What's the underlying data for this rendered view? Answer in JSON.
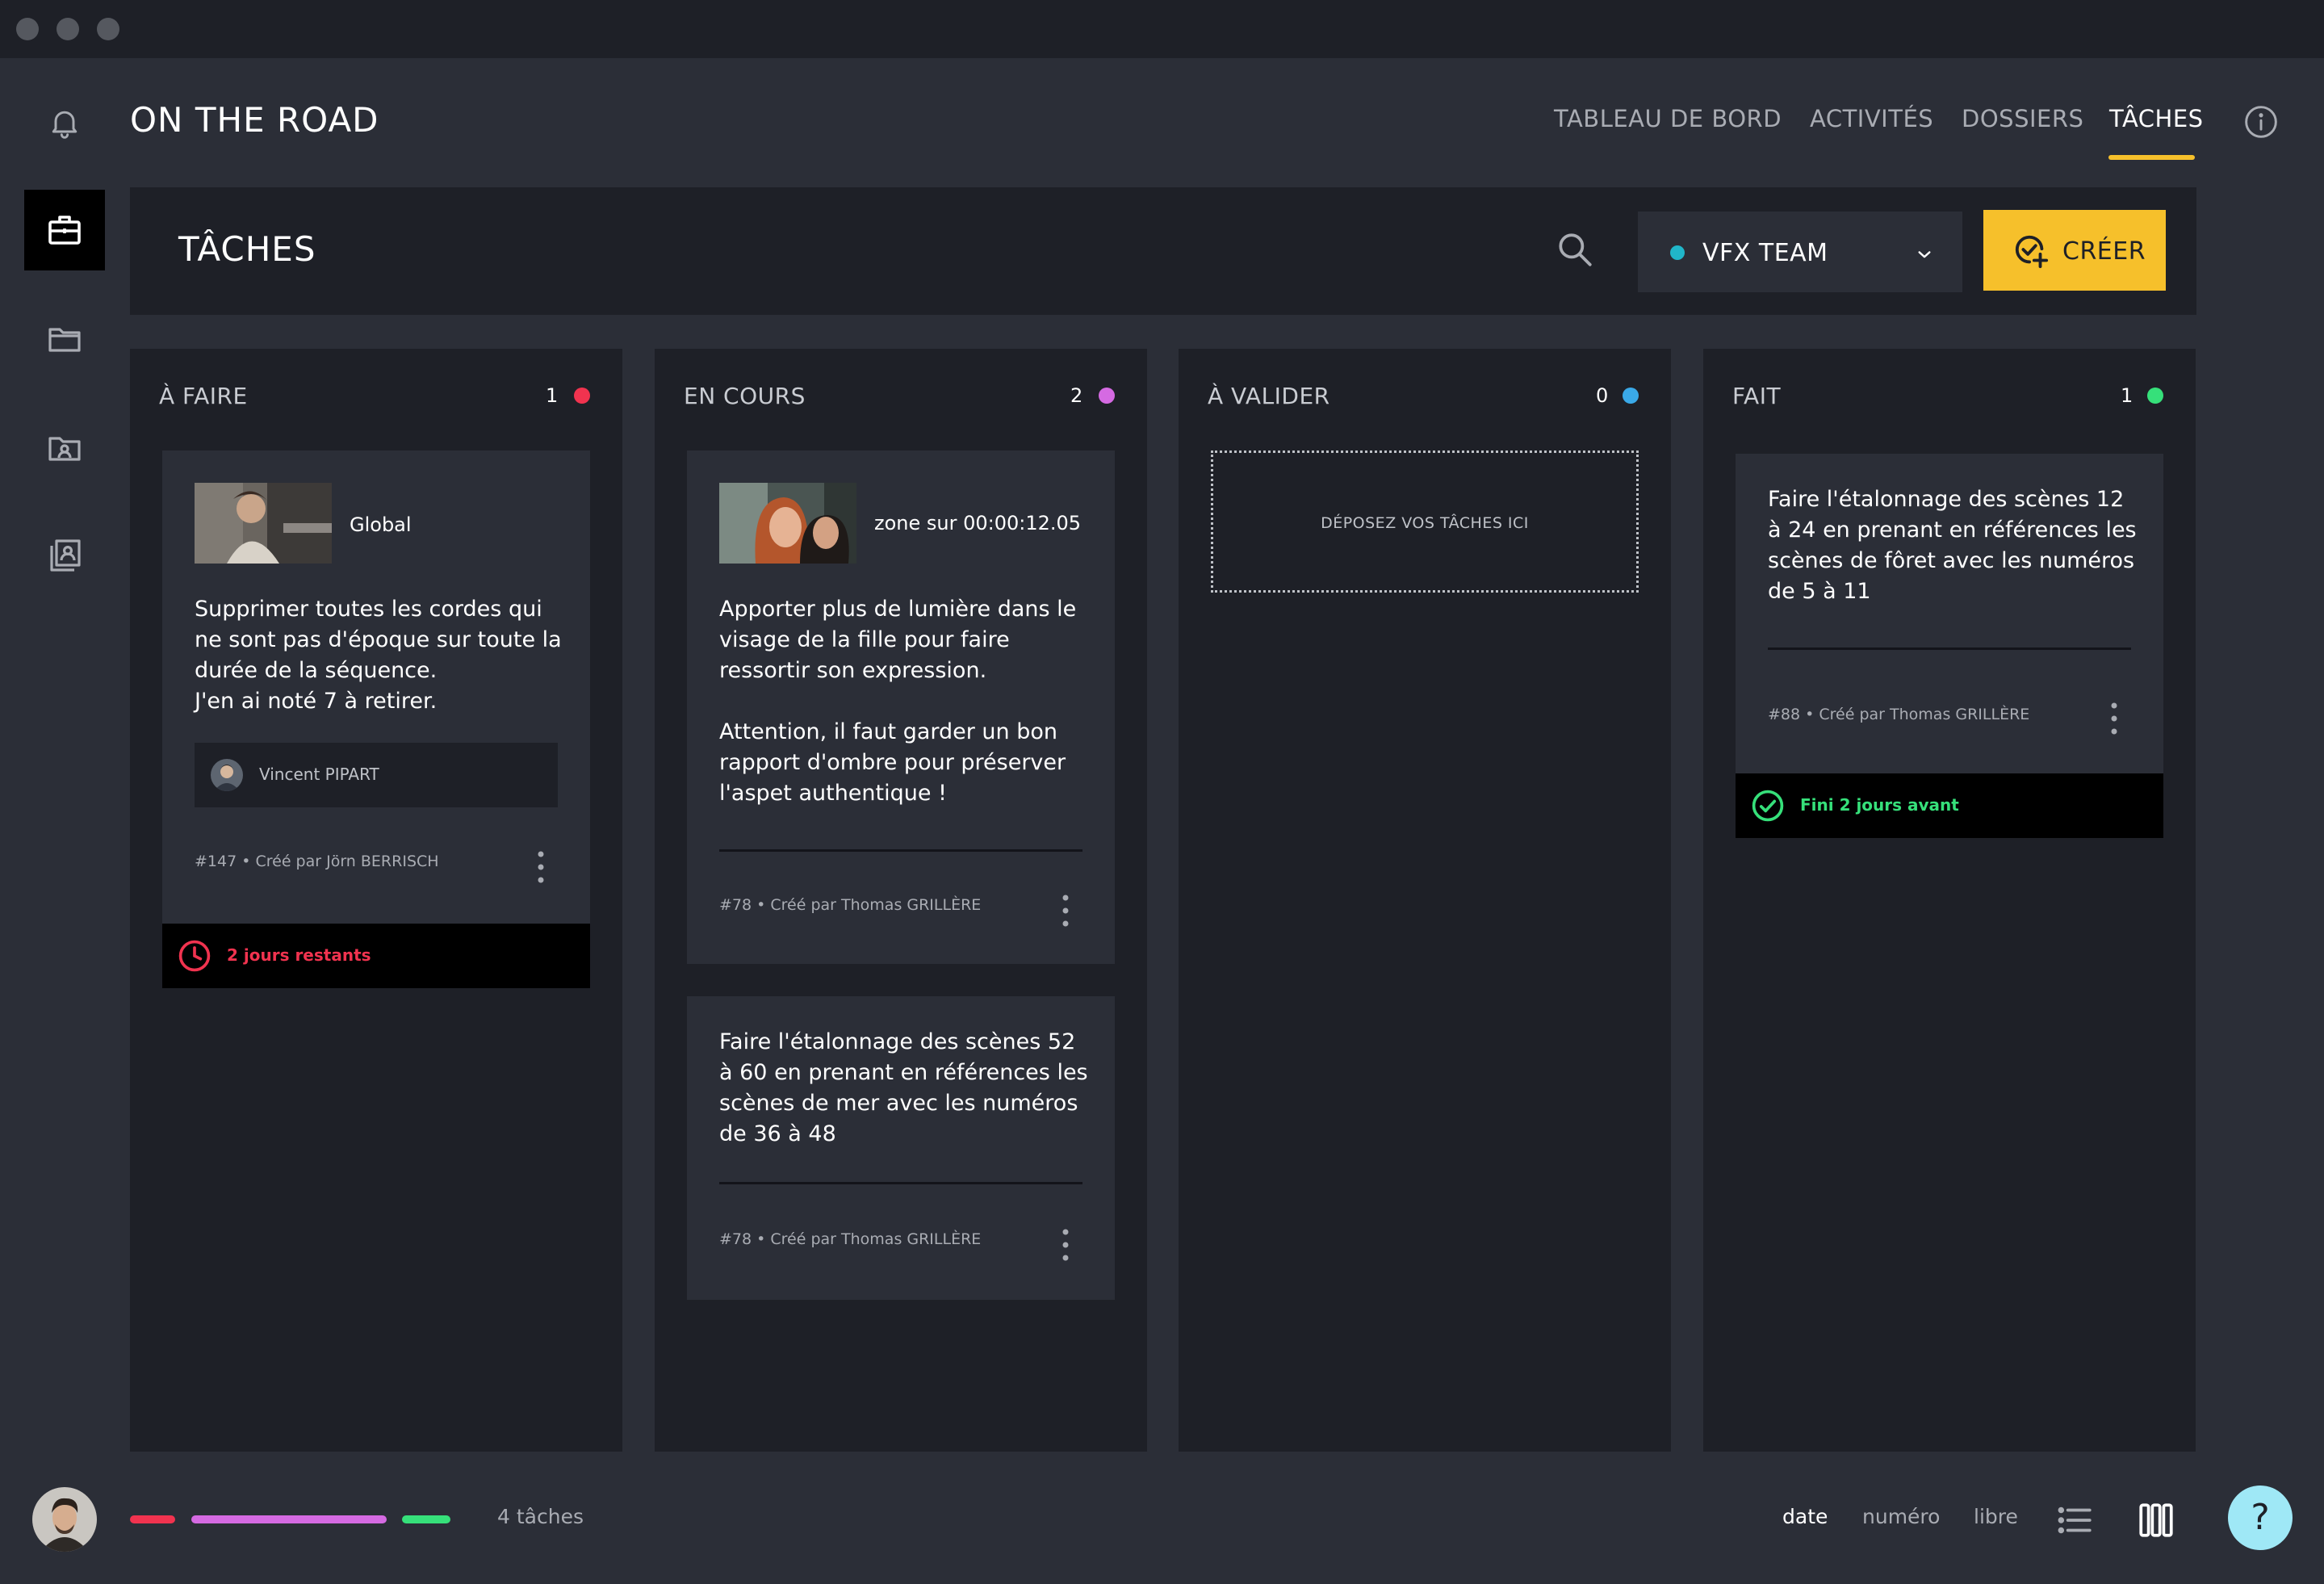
{
  "app": {
    "title": "ON THE ROAD",
    "nav": [
      {
        "label": "TABLEAU DE BORD",
        "active": false
      },
      {
        "label": "ACTIVITÉS",
        "active": false
      },
      {
        "label": "DOSSIERS",
        "active": false
      },
      {
        "label": "TÂCHES",
        "active": true
      }
    ],
    "accent_color": "#f6c02b"
  },
  "page": {
    "title": "TÂCHES",
    "team_select": {
      "label": "VFX TEAM",
      "dot_color": "#20b6c9"
    },
    "create_label": "CRÉER"
  },
  "columns": [
    {
      "title": "À FAIRE",
      "count": "1",
      "dot_color": "#f1334f"
    },
    {
      "title": "EN COURS",
      "count": "2",
      "dot_color": "#d56ae2"
    },
    {
      "title": "À VALIDER",
      "count": "0",
      "dot_color": "#3aa9e8",
      "dropzone": "DÉPOSEZ VOS TÂCHES ICI"
    },
    {
      "title": "FAIT",
      "count": "1",
      "dot_color": "#36e07a"
    }
  ],
  "cards": {
    "todo_1": {
      "thumb_label": "Global",
      "text": "Supprimer toutes les cordes qui ne sont pas d'époque sur toute la durée de la séquence.\nJ'en ai noté 7 à retirer.",
      "assignee": "Vincent PIPART",
      "meta": "#147  •  Créé par Jörn BERRISCH",
      "footer": "2 jours restants",
      "footer_color": "#f1334f"
    },
    "inprogress_1": {
      "thumb_label": "zone sur 00:00:12.05",
      "text": "Apporter plus de lumière dans le visage de la fille pour faire ressortir son expression.\n\nAttention, il faut garder un bon rapport d'ombre pour préserver l'aspet authentique !",
      "meta": "#78  •  Créé par Thomas GRILLÈRE"
    },
    "inprogress_2": {
      "text": "Faire l'étalonnage des scènes 52 à 60 en prenant en références les scènes de mer avec les numéros de 36 à 48",
      "meta": "#78  •  Créé par Thomas GRILLÈRE"
    },
    "done_1": {
      "text": "Faire l'étalonnage des scènes 12 à 24 en prenant en références les scènes de fôret avec les numéros de 5 à 11",
      "meta": "#88  •  Créé par Thomas GRILLÈRE",
      "footer": "Fini 2 jours avant",
      "footer_color": "#36e07a"
    }
  },
  "bottom": {
    "task_count": "4 tâches",
    "sort": [
      {
        "label": "date",
        "active": true
      },
      {
        "label": "numéro",
        "active": false
      },
      {
        "label": "libre",
        "active": false
      }
    ],
    "help_label": "?"
  }
}
